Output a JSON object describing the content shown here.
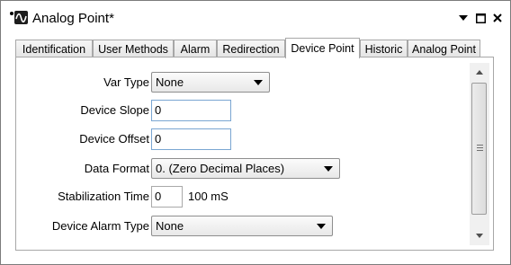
{
  "window": {
    "title": "Analog Point*",
    "icon": "analog-wave-icon",
    "controls": [
      "dropdown-menu-icon",
      "maximize-icon",
      "close-icon"
    ]
  },
  "tabs": [
    {
      "label": "Identification"
    },
    {
      "label": "User Methods"
    },
    {
      "label": "Alarm"
    },
    {
      "label": "Redirection"
    },
    {
      "label": "Device Point",
      "active": true
    },
    {
      "label": "Historic"
    },
    {
      "label": "Analog Point"
    }
  ],
  "form": {
    "var_type": {
      "label": "Var Type",
      "value": "None"
    },
    "device_slope": {
      "label": "Device Slope",
      "value": "0"
    },
    "device_offset": {
      "label": "Device Offset",
      "value": "0"
    },
    "data_format": {
      "label": "Data Format",
      "value": "0. (Zero Decimal Places)"
    },
    "stabilization_time": {
      "label": "Stabilization Time",
      "value": "0",
      "unit": "100 mS"
    },
    "device_alarm_type": {
      "label": "Device Alarm Type",
      "value": "None"
    }
  }
}
